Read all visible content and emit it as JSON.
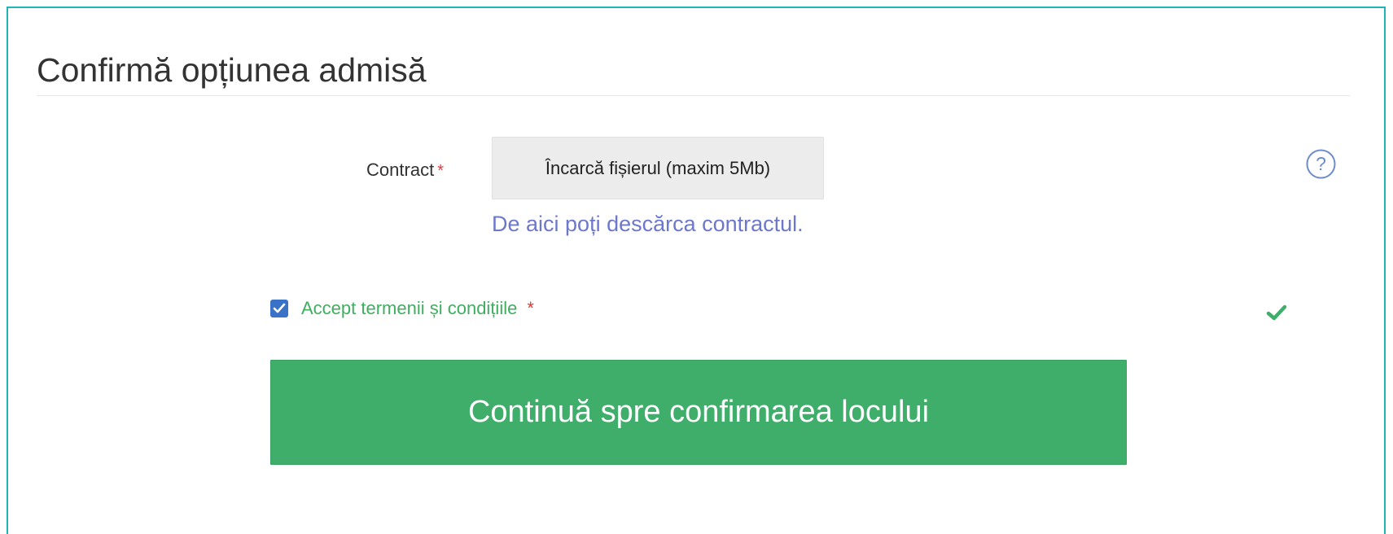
{
  "form": {
    "title": "Confirmă opțiunea admisă",
    "contract": {
      "label": "Contract",
      "required_mark": "*",
      "upload_button_label": "Încarcă fișierul (maxim 5Mb)",
      "download_link_text": "De aici poți descărca contractul."
    },
    "help": {
      "icon": "question-circle-icon"
    },
    "terms": {
      "checked": true,
      "label": "Accept termenii și condițiile",
      "required_mark": "*",
      "status_icon": "checkmark-icon"
    },
    "submit_button_label": "Continuă spre confirmarea locului"
  },
  "colors": {
    "panel_border": "#1fb5b5",
    "link": "#6d78cc",
    "success_green": "#3fae6a",
    "required_red": "#e03a3a",
    "checkbox_blue": "#3a72c8"
  }
}
